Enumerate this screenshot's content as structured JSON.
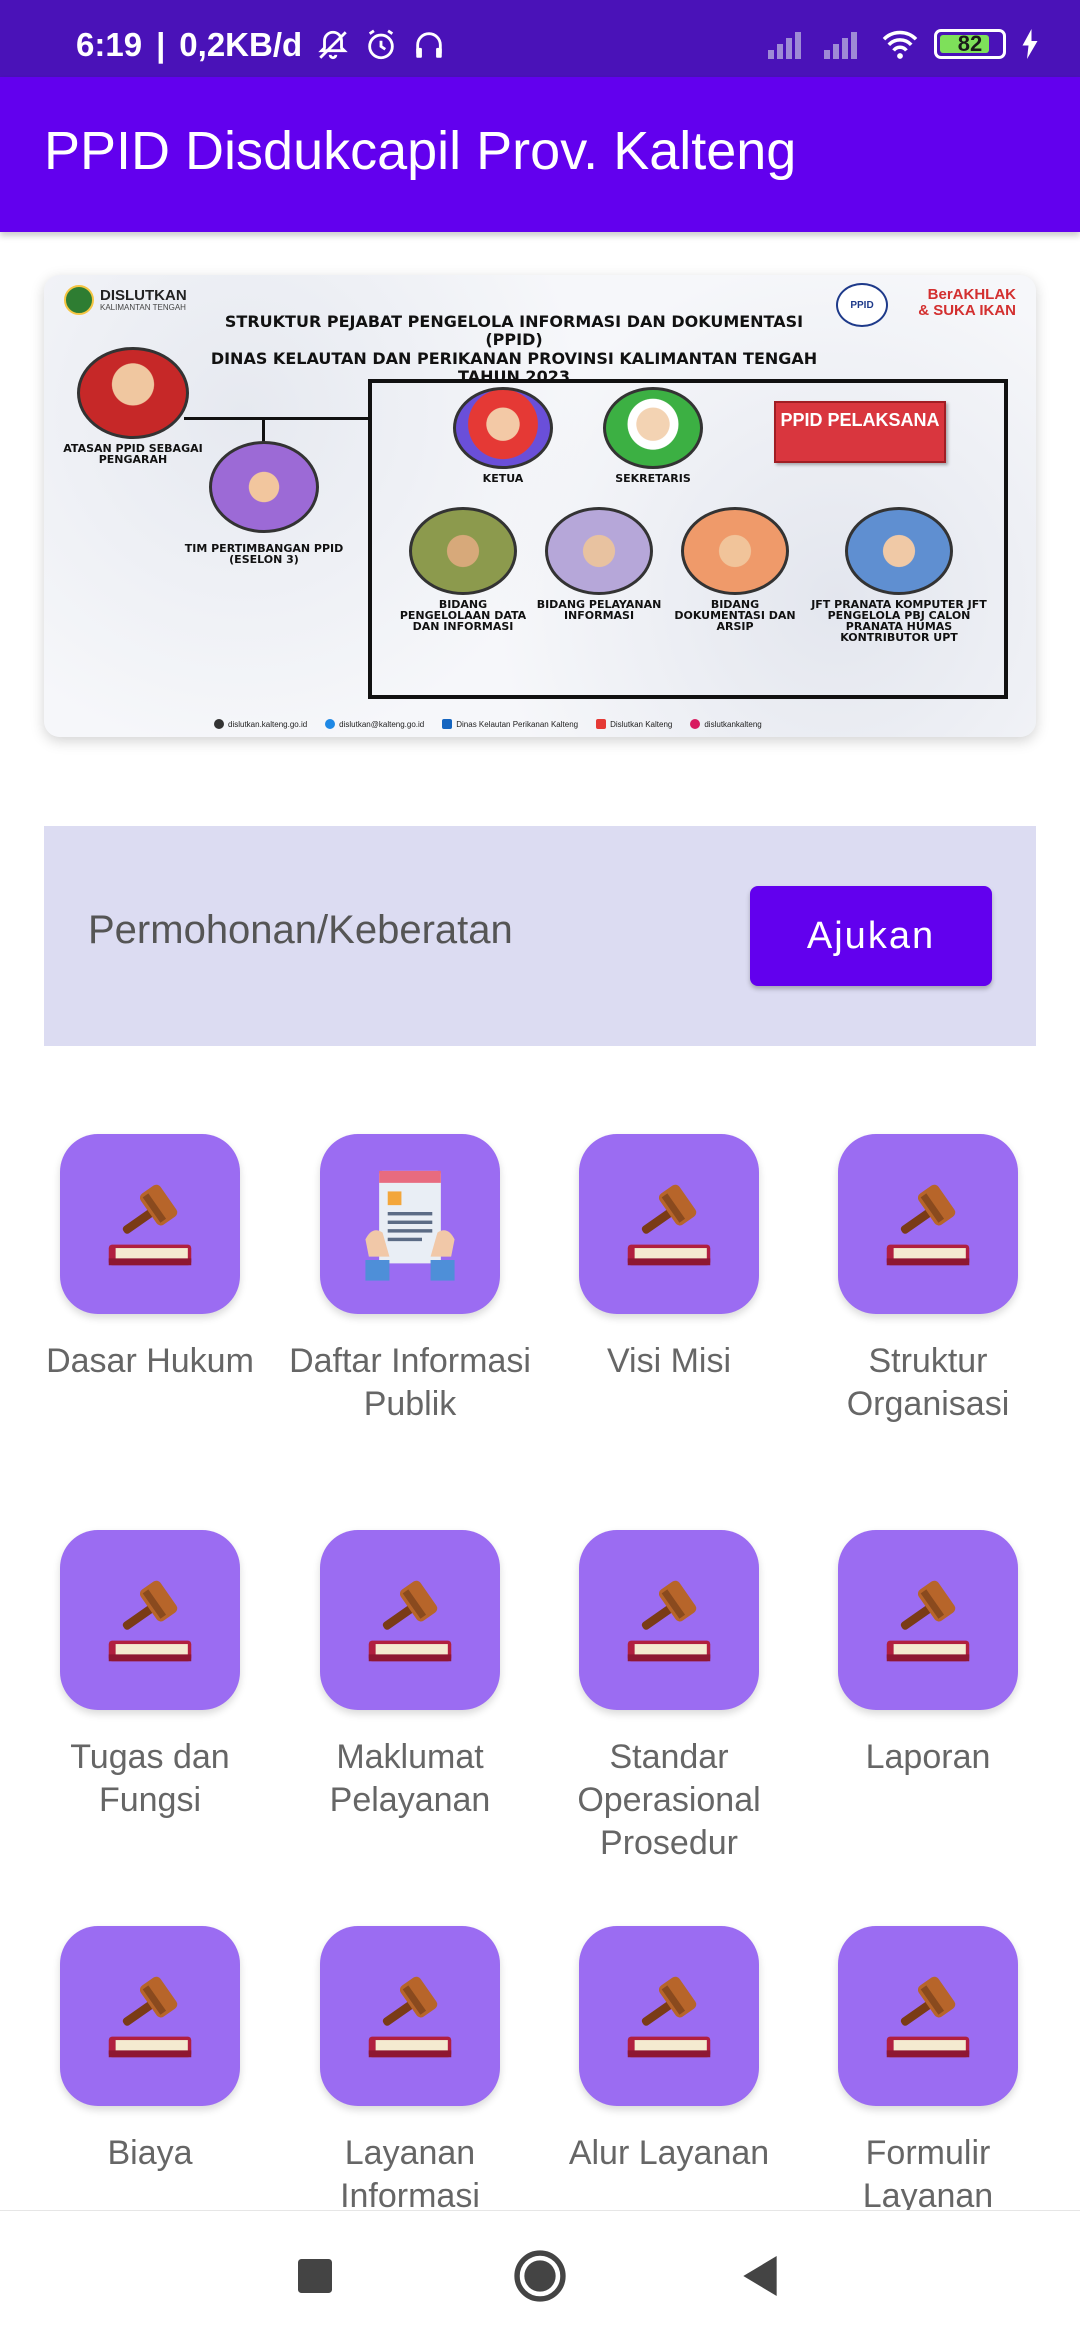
{
  "status": {
    "time": "6:19",
    "speed": "0,2KB/d",
    "battery": "82",
    "battery_fraction": 0.82
  },
  "app": {
    "title": "PPID Disdukcapil Prov. Kalteng"
  },
  "banner": {
    "org_name": "DISLUTKAN",
    "org_sub": "KALIMANTAN TENGAH",
    "badge_line1": "BerAKHLAK",
    "badge_line2": "& SUKA IKAN",
    "ppid_logo": "PPID",
    "title_line1": "STRUKTUR PEJABAT PENGELOLA INFORMASI DAN DOKUMENTASI (PPID)",
    "title_line2": "DINAS KELAUTAN DAN PERIKANAN PROVINSI KALIMANTAN TENGAH",
    "title_line3": "TAHUN 2023",
    "atasan": "ATASAN PPID SEBAGAI PENGARAH",
    "tim": "TIM PERTIMBANGAN PPID (ESELON 3)",
    "ketua": "KETUA",
    "sekretaris": "SEKRETARIS",
    "pelaksana": "PPID PELAKSANA",
    "bidang1": "BIDANG PENGELOLAAN DATA DAN INFORMASI",
    "bidang2": "BIDANG PELAYANAN INFORMASI",
    "bidang3": "BIDANG DOKUMENTASI DAN ARSIP",
    "jft": "JFT PRANATA KOMPUTER JFT PENGELOLA PBJ CALON PRANATA HUMAS KONTRIBUTOR UPT",
    "footer": [
      "dislutkan.kalteng.go.id",
      "dislutkan@kalteng.go.id",
      "Dinas Kelautan Perikanan Kalteng",
      "Dislutkan Kalteng",
      "dislutkankalteng"
    ]
  },
  "request": {
    "label": "Permohonan/Keberatan",
    "button": "Ajukan"
  },
  "menu": [
    {
      "label": "Dasar Hukum",
      "icon": "gavel-icon"
    },
    {
      "label": "Daftar Informasi Publik",
      "icon": "document-icon"
    },
    {
      "label": "Visi Misi",
      "icon": "gavel-icon"
    },
    {
      "label": "Struktur Organisasi",
      "icon": "gavel-icon"
    },
    {
      "label": "Tugas dan Fungsi",
      "icon": "gavel-icon"
    },
    {
      "label": "Maklumat Pelayanan",
      "icon": "gavel-icon"
    },
    {
      "label": "Standar Operasional Prosedur",
      "icon": "gavel-icon"
    },
    {
      "label": "Laporan",
      "icon": "gavel-icon"
    },
    {
      "label": "Biaya",
      "icon": "gavel-icon"
    },
    {
      "label": "Layanan Informasi",
      "icon": "gavel-icon"
    },
    {
      "label": "Alur Layanan",
      "icon": "gavel-icon"
    },
    {
      "label": "Formulir Layanan",
      "icon": "gavel-icon"
    }
  ],
  "colors": {
    "status_bar": "#4a12b8",
    "primary": "#6200ee",
    "tile": "#9b6cf2",
    "panel": "#dcdcf2"
  }
}
